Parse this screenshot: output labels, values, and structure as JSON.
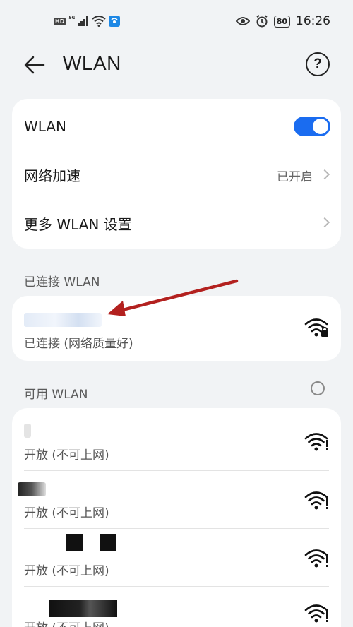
{
  "status_bar": {
    "left_badges": [
      "HD",
      "5G"
    ],
    "battery": "80",
    "time": "16:26",
    "icons": [
      "hd-badge",
      "5g-signal-icon",
      "wifi-status-icon",
      "hotspot-icon",
      "eye-icon",
      "alarm-icon",
      "battery-icon"
    ]
  },
  "app_bar": {
    "title": "WLAN",
    "back_icon": "back-arrow-icon",
    "help_icon": "help-circle-icon",
    "help_glyph": "?"
  },
  "settings": {
    "wlan_label": "WLAN",
    "wlan_enabled": true,
    "accelerate_label": "网络加速",
    "accelerate_value": "已开启",
    "more_label": "更多 WLAN 设置"
  },
  "connected": {
    "section_label": "已连接 WLAN",
    "status": "已连接 (网络质量好)"
  },
  "available": {
    "section_label": "可用 WLAN",
    "items": [
      {
        "status": "开放 (不可上网)"
      },
      {
        "status": "开放 (不可上网)"
      },
      {
        "status": "开放 (不可上网)"
      },
      {
        "status": "开放 (不可上网)"
      }
    ]
  },
  "colors": {
    "accent": "#1a6cf0",
    "annotation_arrow": "#b3211f",
    "background": "#f1f3f5",
    "card": "#ffffff"
  }
}
